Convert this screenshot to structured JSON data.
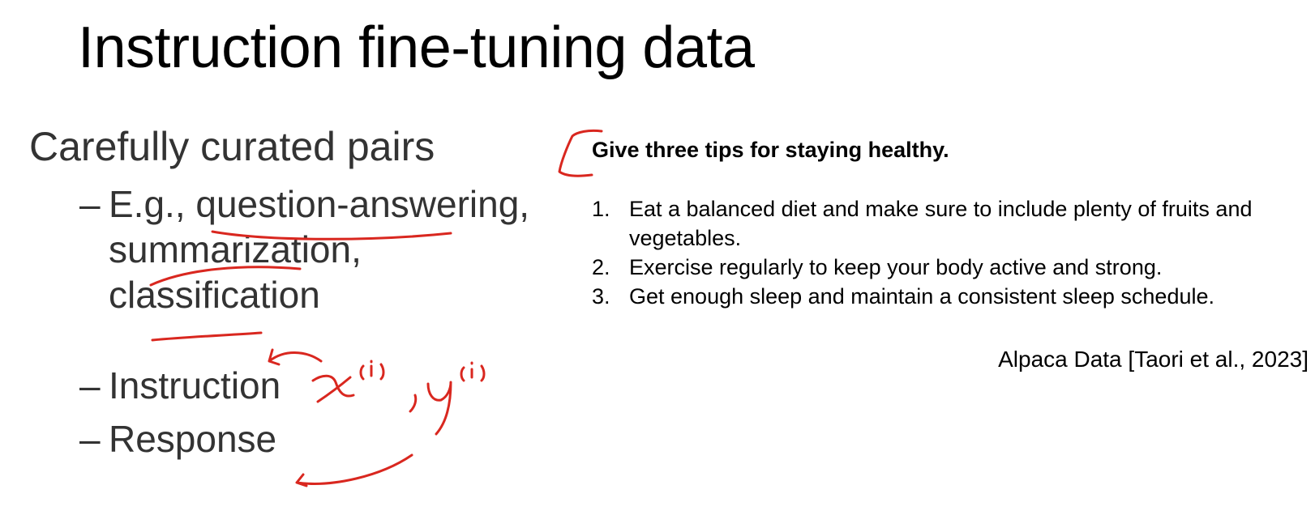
{
  "slide": {
    "title": "Instruction fine-tuning data"
  },
  "left": {
    "main_bullet": "Carefully curated pairs",
    "sub_bullets": [
      {
        "dash": "–",
        "line1": "E.g., question-answering,",
        "line2": "summarization,",
        "line3": "classification"
      },
      {
        "dash": "–",
        "text": "Instruction"
      },
      {
        "dash": "–",
        "text": "Response"
      }
    ]
  },
  "example": {
    "prompt": "Give three tips for staying healthy.",
    "items": [
      {
        "num": "1.",
        "text": "Eat a balanced diet and make sure to include plenty of fruits and vegetables."
      },
      {
        "num": "2.",
        "text": "Exercise regularly to keep your body active and strong."
      },
      {
        "num": "3.",
        "text": "Get enough sleep and maintain a consistent sleep schedule."
      }
    ]
  },
  "citation": "Alpaca Data [Taori et al., 2023]",
  "annotations": {
    "color": "#d9271f",
    "handwritten": [
      "x(i)",
      "y(i)"
    ]
  }
}
